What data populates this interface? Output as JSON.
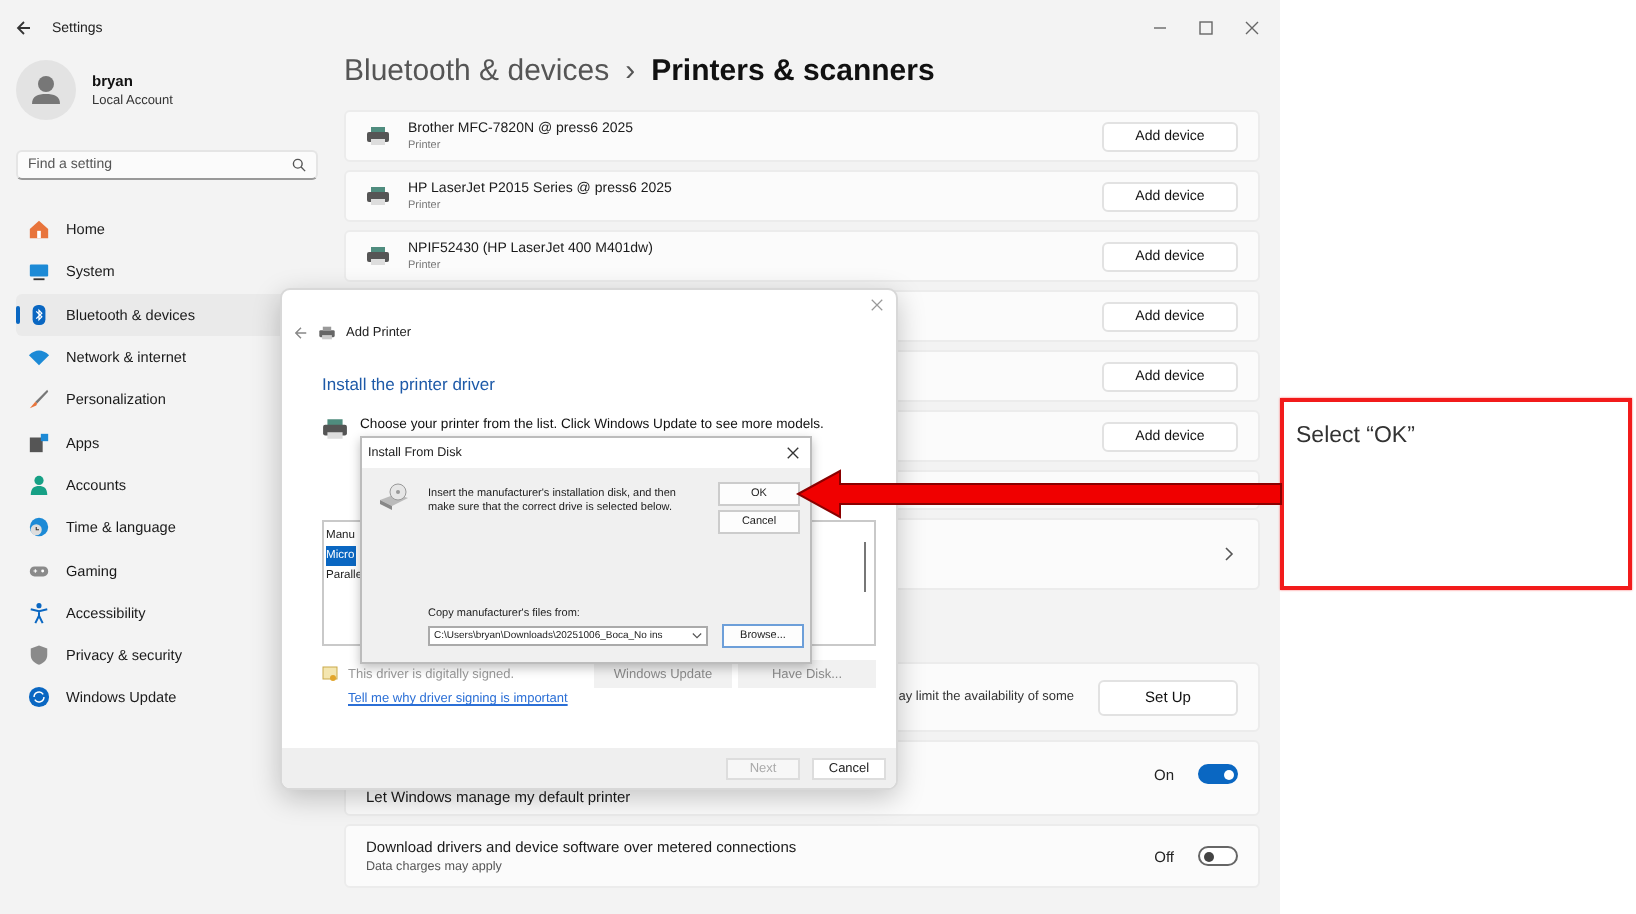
{
  "window": {
    "title": "Settings"
  },
  "user": {
    "name": "bryan",
    "account": "Local Account"
  },
  "search": {
    "placeholder": "Find a setting"
  },
  "nav": [
    {
      "label": "Home",
      "selected": false
    },
    {
      "label": "System",
      "selected": false
    },
    {
      "label": "Bluetooth & devices",
      "selected": true
    },
    {
      "label": "Network & internet",
      "selected": false
    },
    {
      "label": "Personalization",
      "selected": false
    },
    {
      "label": "Apps",
      "selected": false
    },
    {
      "label": "Accounts",
      "selected": false
    },
    {
      "label": "Time & language",
      "selected": false
    },
    {
      "label": "Gaming",
      "selected": false
    },
    {
      "label": "Accessibility",
      "selected": false
    },
    {
      "label": "Privacy & security",
      "selected": false
    },
    {
      "label": "Windows Update",
      "selected": false
    }
  ],
  "breadcrumb": {
    "parent": "Bluetooth & devices",
    "separator": "›",
    "current": "Printers & scanners"
  },
  "cards": [
    {
      "kind": "device",
      "name": "Brother MFC-7820N @ press6 2025",
      "type": "Printer",
      "button": "Add device"
    },
    {
      "kind": "device",
      "name": "HP LaserJet P2015 Series @ press6 2025",
      "type": "Printer",
      "button": "Add device"
    },
    {
      "kind": "device",
      "name": "NPIF52430 (HP LaserJet 400 M401dw)",
      "type": "Printer",
      "button": "Add device"
    },
    {
      "kind": "button",
      "button": "Add device"
    },
    {
      "kind": "button",
      "button": "Add device"
    },
    {
      "kind": "button",
      "button": "Add device"
    },
    {
      "kind": "blank"
    },
    {
      "kind": "chevron"
    },
    {
      "kind": "gap"
    },
    {
      "kind": "setup",
      "text": "ay limit the availability of some",
      "button": "Set Up"
    },
    {
      "kind": "toggle",
      "title": "Let Windows manage my default printer",
      "state": "On",
      "on": true
    },
    {
      "kind": "toggle",
      "title": "Download drivers and device software over metered connections",
      "subtitle": "Data charges may apply",
      "state": "Off",
      "on": false
    }
  ],
  "add_printer": {
    "title": "Add Printer",
    "heading": "Install the printer driver",
    "instruction": "Choose your printer from the list. Click Windows Update to see more models.",
    "list_header": "Manu",
    "list": [
      {
        "text": "Micro",
        "selected": true
      },
      {
        "text": "Paralle",
        "selected": false
      }
    ],
    "signed": "This driver is digitally signed.",
    "buttons": [
      {
        "label": "Windows Update",
        "disabled": true
      },
      {
        "label": "Have Disk...",
        "disabled": true
      }
    ],
    "link": "Tell me why driver signing is important",
    "footer": [
      {
        "label": "Next",
        "disabled": true
      },
      {
        "label": "Cancel",
        "disabled": false
      }
    ]
  },
  "install_from_disk": {
    "title": "Install From Disk",
    "message": "Insert the manufacturer's installation disk, and then make sure that the correct drive is selected below.",
    "buttons": [
      "OK",
      "Cancel"
    ],
    "copy_label": "Copy manufacturer's files from:",
    "path": "C:\\Users\\bryan\\Downloads\\20251006_Boca_No ins",
    "browse": "Browse..."
  },
  "callout": {
    "text": "Select “OK”"
  }
}
